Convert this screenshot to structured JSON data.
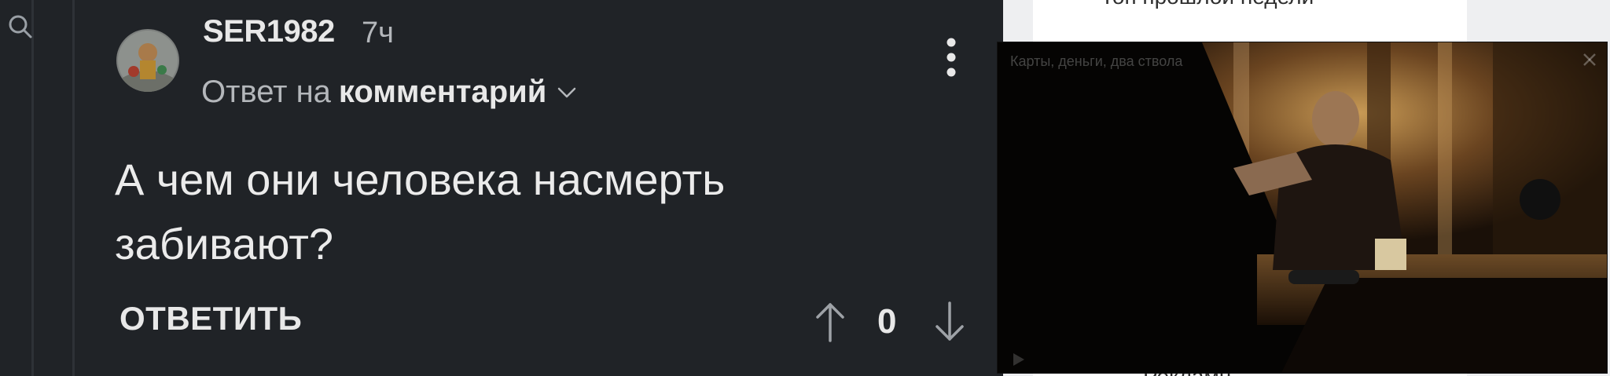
{
  "comment": {
    "username": "SER1982",
    "time": "7ч",
    "reply_prefix": "Ответ на",
    "reply_target": "комментарий",
    "text": "А чем они человека насмерть забивают?",
    "reply_button": "ОТВЕТИТЬ",
    "score": "0"
  },
  "sidebar": {
    "top_link": "Топ прошлой недели",
    "bottom_link": "Рекламн"
  },
  "video": {
    "title": "Карты, деньги, два ствола"
  },
  "colors": {
    "background": "#202327",
    "text": "#e8e8e8",
    "muted_text": "#b4b7bb",
    "sidebar_background": "#eeeff1"
  },
  "icons": [
    "search-icon",
    "chevron-down-icon",
    "more-vertical-icon",
    "arrow-up-icon",
    "arrow-down-icon",
    "close-icon",
    "play-icon"
  ]
}
